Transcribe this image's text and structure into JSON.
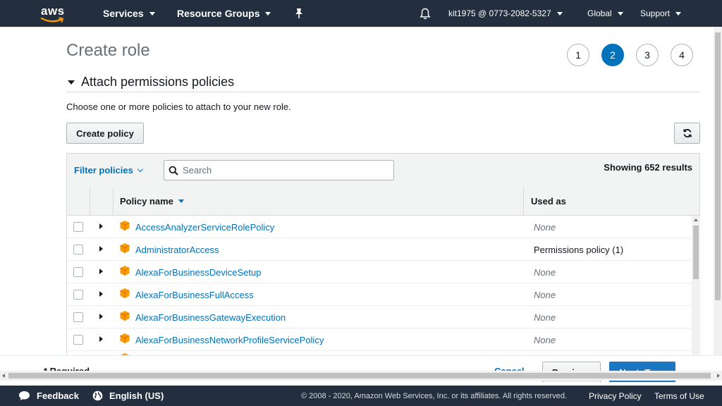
{
  "nav": {
    "logo": "aws",
    "services": "Services",
    "resource_groups": "Resource Groups",
    "account": "kit1975 @ 0773-2082-5327",
    "region": "Global",
    "support": "Support"
  },
  "page": {
    "title": "Create role",
    "steps": [
      "1",
      "2",
      "3",
      "4"
    ],
    "active_step": "2",
    "section_title": "Attach permissions policies",
    "description": "Choose one or more policies to attach to your new role.",
    "create_policy": "Create policy"
  },
  "table": {
    "filter_label": "Filter policies",
    "search_placeholder": "Search",
    "showing": "Showing 652 results",
    "columns": {
      "policy_name": "Policy name",
      "used_as": "Used as"
    },
    "rows": [
      {
        "name": "AccessAnalyzerServiceRolePolicy",
        "used": "None"
      },
      {
        "name": "AdministratorAccess",
        "used": "Permissions policy (1)"
      },
      {
        "name": "AlexaForBusinessDeviceSetup",
        "used": "None"
      },
      {
        "name": "AlexaForBusinessFullAccess",
        "used": "None"
      },
      {
        "name": "AlexaForBusinessGatewayExecution",
        "used": "None"
      },
      {
        "name": "AlexaForBusinessNetworkProfileServicePolicy",
        "used": "None"
      }
    ]
  },
  "actions": {
    "required": "* Required",
    "cancel": "Cancel",
    "previous": "Previous",
    "next": "Next: Tags"
  },
  "footer": {
    "feedback": "Feedback",
    "language": "English (US)",
    "copyright": "© 2008 - 2020, Amazon Web Services, Inc. or its affiliates. All rights reserved.",
    "privacy": "Privacy Policy",
    "terms": "Terms of Use"
  },
  "colors": {
    "nav_bg": "#232f3e",
    "link": "#0073bb",
    "accent_orange": "#f90",
    "primary": "#1c77c3"
  }
}
